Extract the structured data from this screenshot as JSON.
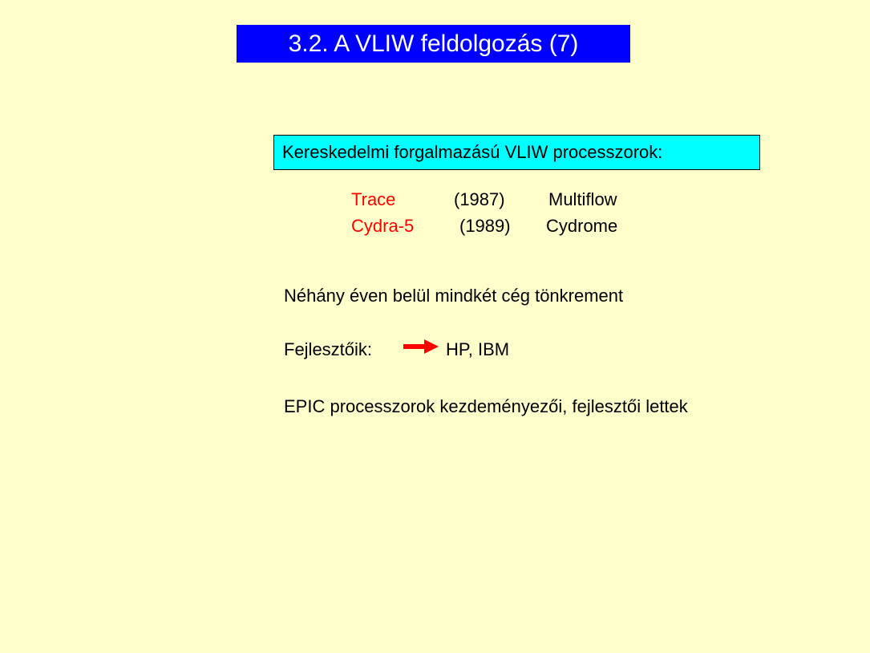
{
  "title": "3.2. A VLIW feldolgozás (7)",
  "box_heading": "Kereskedelmi forgalmazású VLIW processzorok:",
  "processors": [
    {
      "name": "Trace",
      "year": "(1987)",
      "company": "Multiflow"
    },
    {
      "name": "Cydra-5",
      "year": "(1989)",
      "company": "Cydrome"
    }
  ],
  "statement": "Néhány éven belül mindkét cég tönkrement",
  "developers": {
    "label": "Fejlesztőik:",
    "arrow_icon": "right-arrow-icon",
    "value": "HP, IBM"
  },
  "conclusion": "EPIC processzorok kezdeményezői, fejlesztői lettek",
  "colors": {
    "background": "#ffffcc",
    "title_bg": "#0000ff",
    "box_bg": "#00ffff",
    "highlight": "#ff0000"
  }
}
